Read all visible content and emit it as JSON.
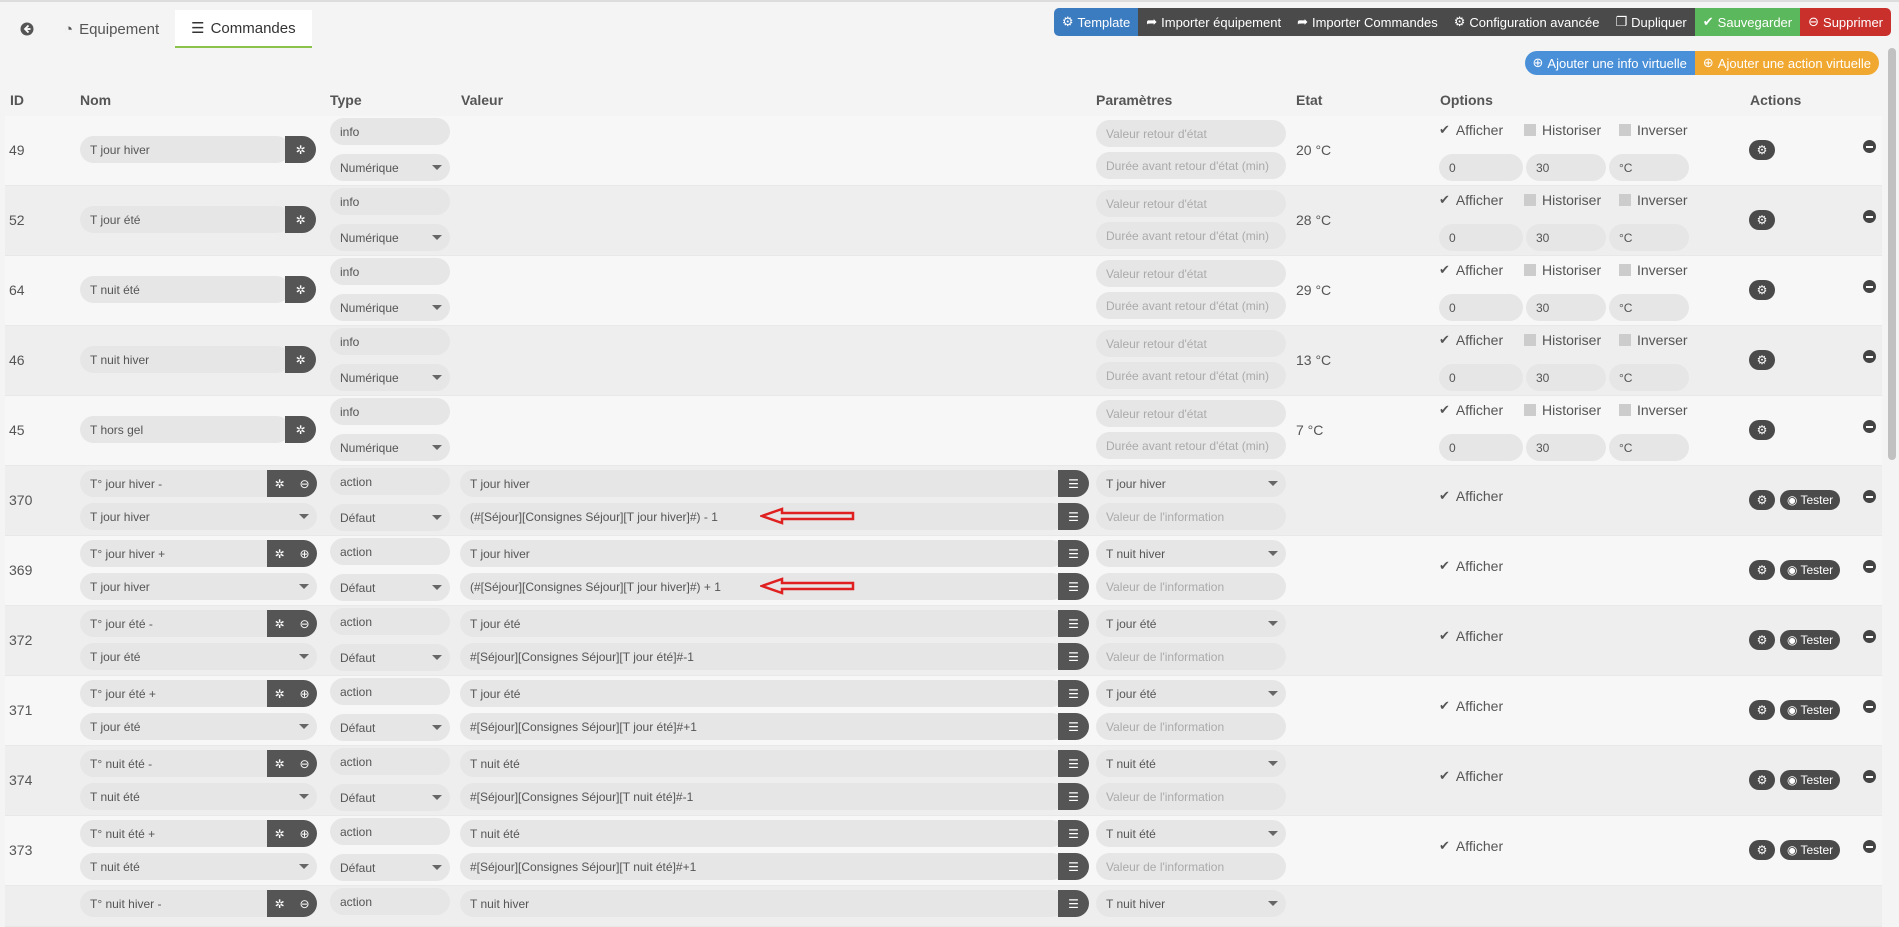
{
  "tabs": {
    "back_icon": "arrow-circle-left-icon",
    "equipement": "Equipement",
    "commandes": "Commandes"
  },
  "toolbar": {
    "template": "Template",
    "import_equipement": "Importer équipement",
    "import_commandes": "Importer Commandes",
    "config_avancee": "Configuration avancée",
    "dupliquer": "Dupliquer",
    "sauvegarder": "Sauvegarder",
    "supprimer": "Supprimer"
  },
  "virtual": {
    "add_info": "Ajouter une info virtuelle",
    "add_action": "Ajouter une action virtuelle"
  },
  "headers": {
    "id": "ID",
    "nom": "Nom",
    "type": "Type",
    "valeur": "Valeur",
    "parametres": "Paramètres",
    "etat": "Etat",
    "options": "Options",
    "actions": "Actions"
  },
  "placeholders": {
    "valeur_retour": "Valeur retour d'état",
    "duree_retour": "Durée avant retour d'état (min)",
    "valeur_info": "Valeur de l'information"
  },
  "labels": {
    "afficher": "Afficher",
    "historiser": "Historiser",
    "inverser": "Inverser",
    "tester": "Tester"
  },
  "info_rows": [
    {
      "id": "49",
      "nom": "T jour hiver",
      "type": "info",
      "subtype": "Numérique",
      "etat": "20 °C",
      "min": "0",
      "max": "30",
      "unit": "°C"
    },
    {
      "id": "52",
      "nom": "T jour été",
      "type": "info",
      "subtype": "Numérique",
      "etat": "28 °C",
      "min": "0",
      "max": "30",
      "unit": "°C"
    },
    {
      "id": "64",
      "nom": "T nuit été",
      "type": "info",
      "subtype": "Numérique",
      "etat": "29 °C",
      "min": "0",
      "max": "30",
      "unit": "°C"
    },
    {
      "id": "46",
      "nom": "T nuit hiver",
      "type": "info",
      "subtype": "Numérique",
      "etat": "13 °C",
      "min": "0",
      "max": "30",
      "unit": "°C"
    },
    {
      "id": "45",
      "nom": "T hors gel",
      "type": "info",
      "subtype": "Numérique",
      "etat": "7 °C",
      "min": "0",
      "max": "30",
      "unit": "°C"
    }
  ],
  "action_rows": [
    {
      "id": "370",
      "nom": "T° jour hiver -",
      "link": "T jour hiver",
      "type": "action",
      "subtype": "Défaut",
      "valeur": "T jour hiver",
      "formula": "(#[Séjour][Consignes Séjour][T jour hiver]#) - 1",
      "param": "T jour hiver",
      "sign": "-"
    },
    {
      "id": "369",
      "nom": "T° jour hiver +",
      "link": "T jour hiver",
      "type": "action",
      "subtype": "Défaut",
      "valeur": "T jour hiver",
      "formula": "(#[Séjour][Consignes Séjour][T jour hiver]#) + 1",
      "param": "T nuit hiver",
      "sign": "+"
    },
    {
      "id": "372",
      "nom": "T° jour été -",
      "link": "T jour été",
      "type": "action",
      "subtype": "Défaut",
      "valeur": "T jour été",
      "formula": "#[Séjour][Consignes Séjour][T jour été]#-1",
      "param": "T jour été",
      "sign": "-"
    },
    {
      "id": "371",
      "nom": "T° jour été +",
      "link": "T jour été",
      "type": "action",
      "subtype": "Défaut",
      "valeur": "T jour été",
      "formula": "#[Séjour][Consignes Séjour][T jour été]#+1",
      "param": "T jour été",
      "sign": "+"
    },
    {
      "id": "374",
      "nom": "T° nuit été -",
      "link": "T nuit été",
      "type": "action",
      "subtype": "Défaut",
      "valeur": "T nuit été",
      "formula": "#[Séjour][Consignes Séjour][T nuit été]#-1",
      "param": "T nuit été",
      "sign": "-"
    },
    {
      "id": "373",
      "nom": "T° nuit été +",
      "link": "T nuit été",
      "type": "action",
      "subtype": "Défaut",
      "valeur": "T nuit été",
      "formula": "#[Séjour][Consignes Séjour][T nuit été]#+1",
      "param": "T nuit été",
      "sign": "+"
    },
    {
      "id": "",
      "nom": "T° nuit hiver -",
      "link": "",
      "type": "action",
      "subtype": "",
      "valeur": "T nuit hiver",
      "formula": "",
      "param": "T nuit hiver",
      "sign": "-"
    }
  ],
  "colors": {
    "template": "#3b7bbf",
    "save": "#5cb85c",
    "delete": "#c9302c",
    "add_info": "#4a90d9",
    "add_action": "#f0a830",
    "arrow": "#e02020"
  }
}
